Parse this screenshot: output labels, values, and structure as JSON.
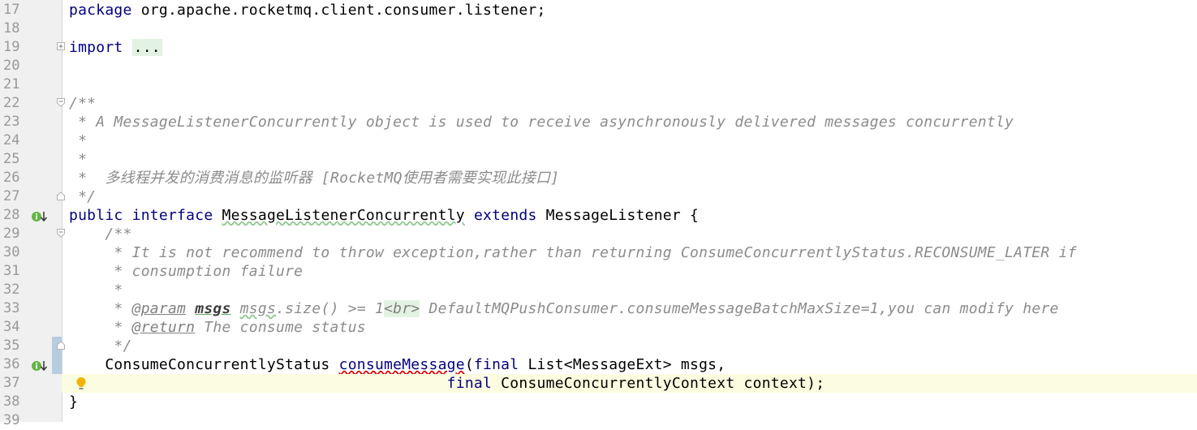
{
  "editor": {
    "colors": {
      "keyword": "#000080",
      "comment": "#8c8c8c",
      "line_number": "#999999",
      "current_line": "#fcfce0",
      "gutter": "#f0f0f0",
      "error_underline": "#e00000"
    },
    "lines": [
      {
        "n": "17",
        "tokens": [
          {
            "c": "kw",
            "t": "package"
          },
          {
            "c": "",
            "t": " org.apache.rocketmq.client.consumer.listener;"
          }
        ]
      },
      {
        "n": "18",
        "tokens": []
      },
      {
        "n": "19",
        "fold": "plus",
        "tokens": [
          {
            "c": "kw",
            "t": "import"
          },
          {
            "c": "",
            "t": " "
          },
          {
            "c": "fold-box",
            "t": "..."
          }
        ]
      },
      {
        "n": "20",
        "tokens": []
      },
      {
        "n": "21",
        "tokens": []
      },
      {
        "n": "22",
        "fold": "minus",
        "tokens": [
          {
            "c": "cm",
            "t": "/**"
          }
        ]
      },
      {
        "n": "23",
        "tokens": [
          {
            "c": "cm",
            "t": " * A MessageListenerConcurrently object is used to receive asynchronously delivered messages concurrently"
          }
        ]
      },
      {
        "n": "24",
        "tokens": [
          {
            "c": "cm",
            "t": " *"
          }
        ]
      },
      {
        "n": "25",
        "tokens": [
          {
            "c": "cm",
            "t": " *"
          }
        ]
      },
      {
        "n": "26",
        "tokens": [
          {
            "c": "cm",
            "t": " *  多线程并发的消费消息的监听器 [RocketMQ使用者需要实现此接口]"
          }
        ]
      },
      {
        "n": "27",
        "fold": "end",
        "tokens": [
          {
            "c": "cm",
            "t": " */"
          }
        ]
      },
      {
        "n": "28",
        "icon": "implemented-icon",
        "tokens": [
          {
            "c": "kw",
            "t": "public"
          },
          {
            "c": "",
            "t": " "
          },
          {
            "c": "kw",
            "t": "interface"
          },
          {
            "c": "",
            "t": " "
          },
          {
            "c": "warn",
            "t": "MessageListenerConcurrently"
          },
          {
            "c": "",
            "t": " "
          },
          {
            "c": "kw",
            "t": "extends"
          },
          {
            "c": "",
            "t": " MessageListener {"
          }
        ]
      },
      {
        "n": "29",
        "fold": "minus",
        "tokens": [
          {
            "c": "cm",
            "t": "    /**"
          }
        ]
      },
      {
        "n": "30",
        "tokens": [
          {
            "c": "cm",
            "t": "     * It is not recommend to throw exception,rather than returning ConsumeConcurrentlyStatus.RECONSUME_LATER if"
          }
        ]
      },
      {
        "n": "31",
        "tokens": [
          {
            "c": "cm",
            "t": "     * consumption failure"
          }
        ]
      },
      {
        "n": "32",
        "tokens": [
          {
            "c": "cm",
            "t": "     *"
          }
        ]
      },
      {
        "n": "33",
        "tokens": [
          {
            "c": "cm",
            "t": "     * "
          },
          {
            "c": "tg",
            "t": "@param"
          },
          {
            "c": "cm",
            "t": " "
          },
          {
            "c": "pn",
            "t": "msgs"
          },
          {
            "c": "cm",
            "t": " "
          },
          {
            "c": "cm warn",
            "t": "msgs"
          },
          {
            "c": "cm",
            "t": ".size() >= 1"
          },
          {
            "c": "tgh",
            "t": "<br>"
          },
          {
            "c": "cm",
            "t": " DefaultMQPushConsumer.consumeMessageBatchMaxSize=1,you can modify here"
          }
        ]
      },
      {
        "n": "34",
        "tokens": [
          {
            "c": "cm",
            "t": "     * "
          },
          {
            "c": "tg",
            "t": "@return"
          },
          {
            "c": "cm",
            "t": " The consume status"
          }
        ]
      },
      {
        "n": "35",
        "fold": "end",
        "tokens": [
          {
            "c": "cm",
            "t": "     */"
          }
        ]
      },
      {
        "n": "36",
        "icon": "implemented-icon",
        "tokens": [
          {
            "c": "",
            "t": "    ConsumeConcurrentlyStatus "
          },
          {
            "c": "err kw",
            "t": "consumeMessage"
          },
          {
            "c": "",
            "t": "("
          },
          {
            "c": "kw",
            "t": "final"
          },
          {
            "c": "",
            "t": " List<MessageExt> msgs,"
          }
        ]
      },
      {
        "n": "37",
        "current": true,
        "icon": "bulb-icon",
        "tokens": [
          {
            "c": "",
            "t": "                                          "
          },
          {
            "c": "kw",
            "t": "final"
          },
          {
            "c": "",
            "t": " ConsumeConcurrentlyContext context);"
          }
        ]
      },
      {
        "n": "38",
        "tokens": [
          {
            "c": "",
            "t": "}"
          }
        ]
      },
      {
        "n": "39",
        "tokens": []
      }
    ]
  }
}
